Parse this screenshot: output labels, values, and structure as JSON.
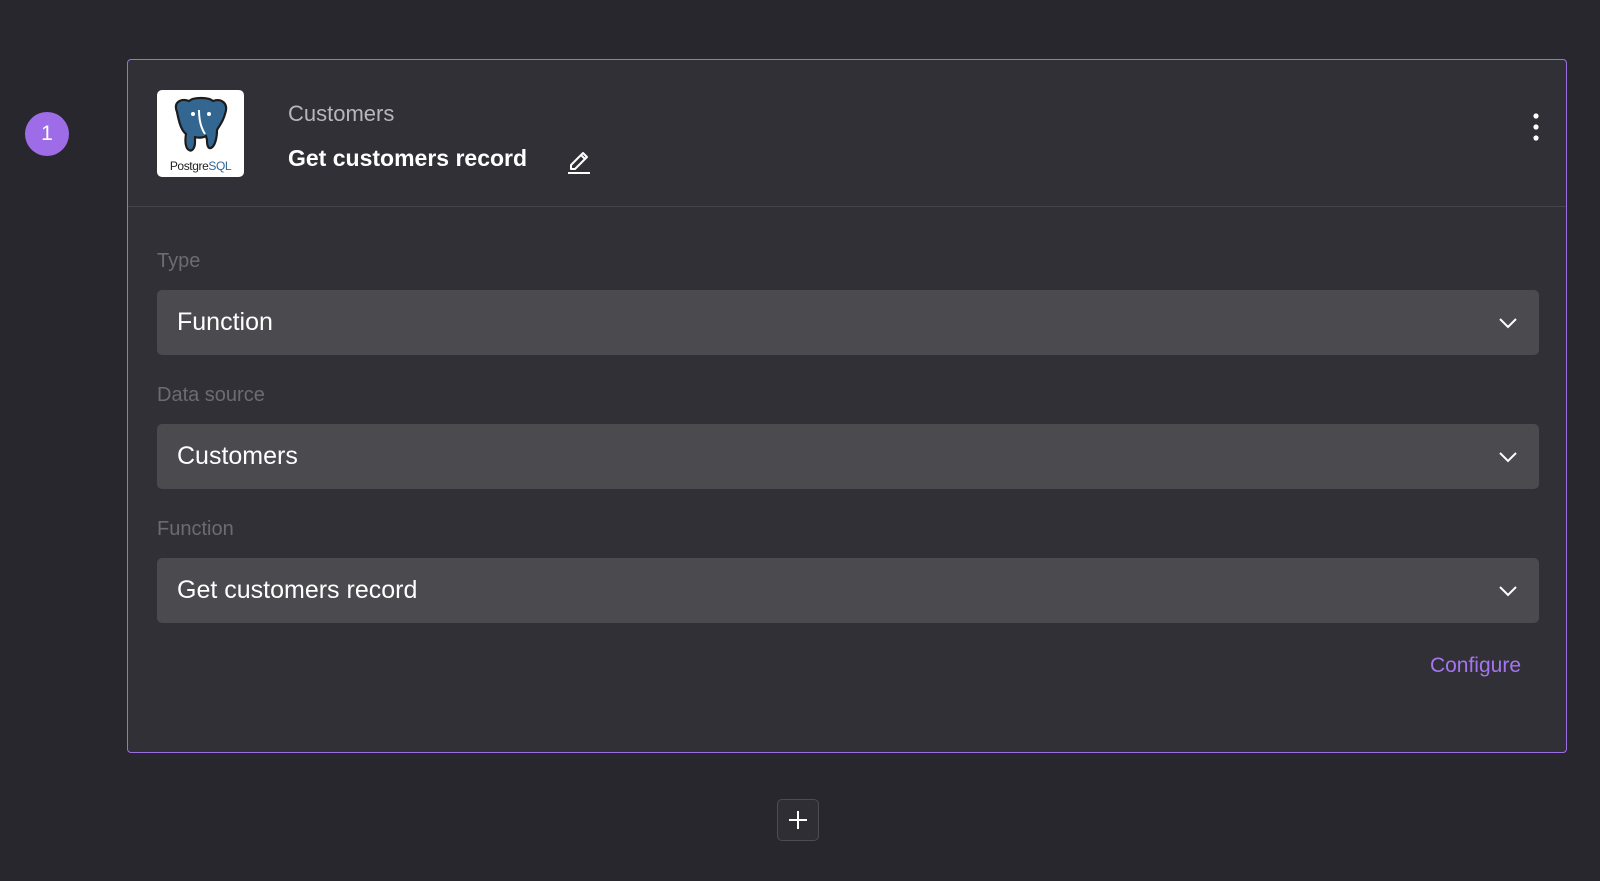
{
  "step": {
    "number": "1"
  },
  "card": {
    "subtitle": "Customers",
    "title": "Get customers record",
    "logo": {
      "text_left": "Postgre",
      "text_right": "SQL"
    },
    "icons": {
      "edit": "pencil-icon",
      "more": "vertical-dots-icon",
      "dropdown": "chevron-down-icon"
    },
    "fields": {
      "type": {
        "label": "Type",
        "value": "Function"
      },
      "data_source": {
        "label": "Data source",
        "value": "Customers"
      },
      "function": {
        "label": "Function",
        "value": "Get customers record"
      }
    },
    "configure_label": "Configure"
  },
  "add_step_icon": "plus-icon",
  "colors": {
    "accent": "#9d6ce6",
    "link": "#a375ef",
    "background": "#28272d",
    "card": "#313036",
    "select": "#4a4a4f"
  }
}
